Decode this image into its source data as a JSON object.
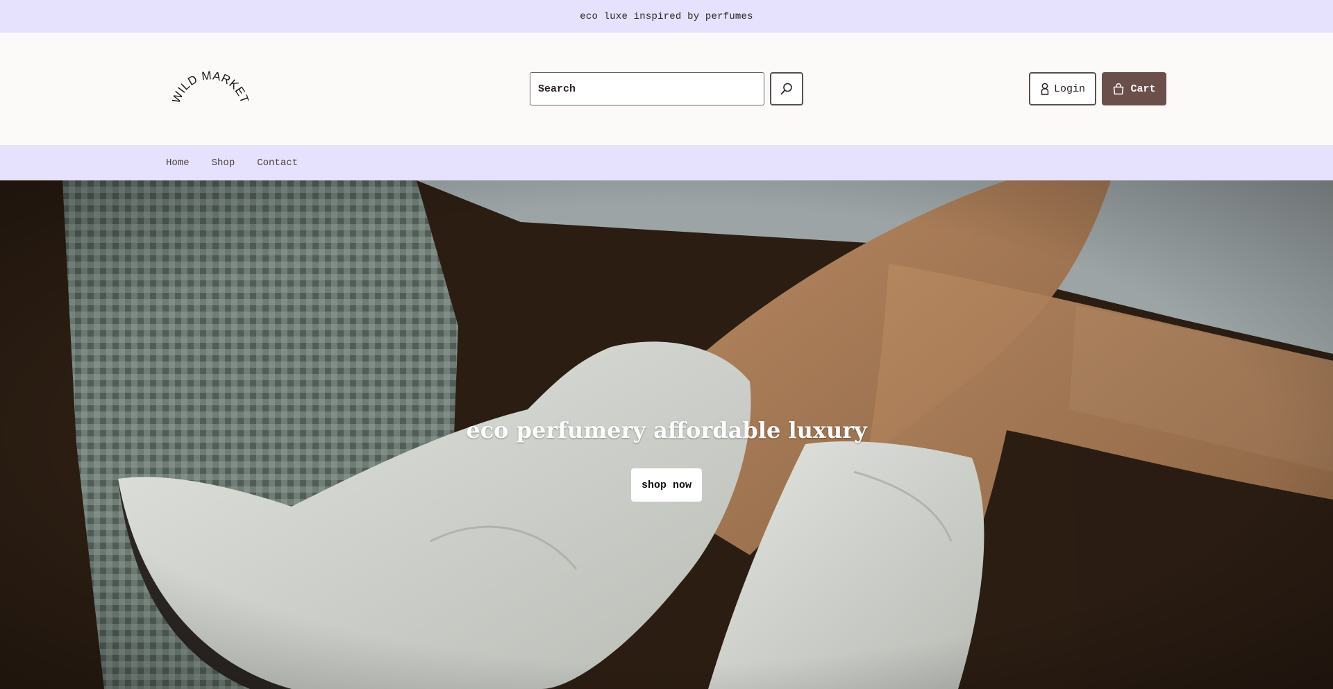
{
  "announcement": {
    "text": "eco luxe inspired by perfumes"
  },
  "header": {
    "logo_text": "WILD MARKET",
    "search": {
      "placeholder": "Search",
      "value": "",
      "icon": "search-icon"
    },
    "login_label": "Login",
    "cart_label": "Cart",
    "login_icon": "user-icon",
    "cart_icon": "bag-icon"
  },
  "nav": {
    "items": [
      {
        "label": "Home"
      },
      {
        "label": "Shop"
      },
      {
        "label": "Contact"
      }
    ]
  },
  "hero": {
    "title": "eco perfumery affordable luxury",
    "button_label": "shop now"
  },
  "colors": {
    "accent_lavender": "#e6e2fd",
    "cart_brown": "#6b4f4b",
    "page_bg": "#fbfaf8"
  }
}
